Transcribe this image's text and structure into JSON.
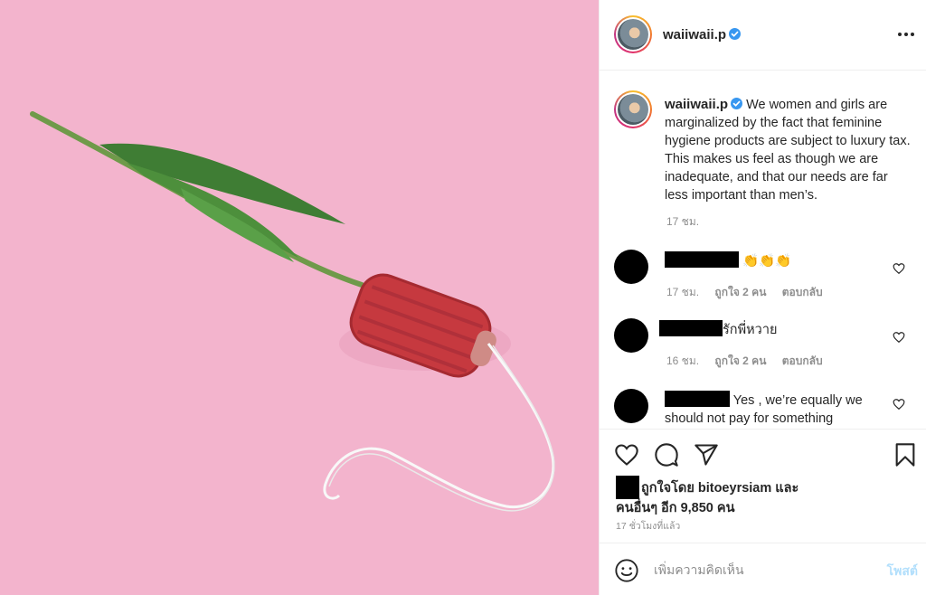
{
  "post": {
    "username": "waiiwaii.p",
    "colors": {
      "photo_bg": "#f3b4cd",
      "verified": "#3897f0",
      "link": "#00376b",
      "muted": "#8e8e8e",
      "post_button_disabled": "#b2dffc"
    }
  },
  "caption": {
    "username": "waiiwaii.p",
    "text": "We women and girls are marginalized by the fact that feminine hygiene products are subject to luxury tax. This makes us feel as though we are inadequate, and that our needs are far less important than men’s.",
    "time": "17 ชม."
  },
  "comments": [
    {
      "text": "👏👏👏",
      "time": "17 ชม.",
      "likes": "ถูกใจ 2 คน",
      "reply": "ตอบกลับ"
    },
    {
      "text": "รักพี่หวาย",
      "time": "16 ชม.",
      "likes": "ถูกใจ 2 คน",
      "reply": "ตอบกลับ"
    },
    {
      "text": "Yes , we’re equally we should not pay for something"
    }
  ],
  "actions": {
    "icons": [
      "heart-icon",
      "comment-icon",
      "share-icon",
      "bookmark-icon"
    ]
  },
  "likes": {
    "line1": "ถูกใจโดย bitoeyrsiam และ",
    "line2": "คนอื่นๆ อีก 9,850 คน"
  },
  "post_time": "17 ชั่วโมงที่แล้ว",
  "comment_box": {
    "placeholder": "เพิ่มความคิดเห็น",
    "post_label": "โพสต์"
  }
}
